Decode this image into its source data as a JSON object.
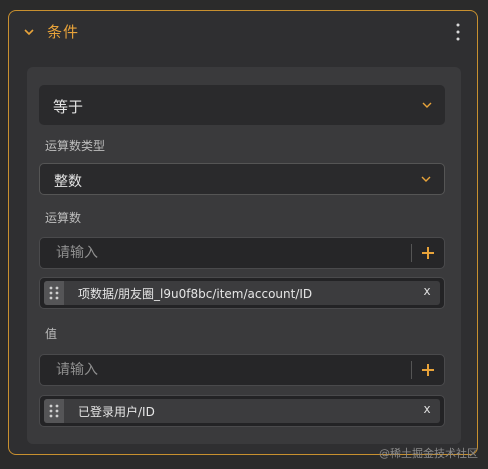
{
  "panel": {
    "title": "条件"
  },
  "operator": {
    "selected": "等于"
  },
  "operand_type": {
    "label": "运算数类型",
    "selected": "整数"
  },
  "operand": {
    "label": "运算数",
    "placeholder": "请输入",
    "chip_text": "项数据/朋友圈_l9u0f8bc/item/account/ID",
    "chip_close": "x"
  },
  "value": {
    "label": "值",
    "placeholder": "请输入",
    "chip_text": "已登录用户/ID",
    "chip_close": "x"
  },
  "watermark": "@稀土掘金技术社区",
  "colors": {
    "accent": "#e8a33a",
    "panel_border": "#c8902f",
    "background": "#2b2b2b"
  },
  "icons": [
    "chevron-down-icon",
    "more-vertical-icon",
    "plus-icon",
    "drag-handle-icon",
    "close-icon"
  ]
}
